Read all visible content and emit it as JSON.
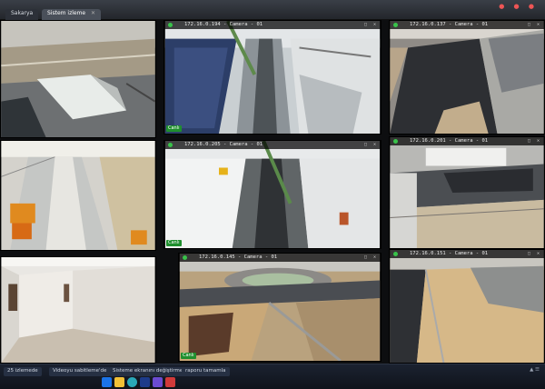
{
  "window": {
    "tabs": [
      {
        "label": "Sakarya",
        "active": false
      },
      {
        "label": "Sistem izleme",
        "active": true
      }
    ]
  },
  "cameras": [
    {
      "ip": "",
      "name": "",
      "status": ""
    },
    {
      "ip": "172.16.0.194 - Camera - 01",
      "name": "",
      "status": "Canlı"
    },
    {
      "ip": "172.16.0.137 - Camera - 01",
      "name": "",
      "status": ""
    },
    {
      "ip": "",
      "name": "",
      "status": ""
    },
    {
      "ip": "172.16.0.205 - Camera - 01",
      "name": "",
      "status": "Canlı"
    },
    {
      "ip": "172.16.0.201 - Camera - 01",
      "name": "",
      "status": ""
    },
    {
      "ip": "",
      "name": "",
      "status": ""
    },
    {
      "ip": "172.16.0.145 - Camera - 01",
      "name": "",
      "status": "Canlı"
    },
    {
      "ip": "172.16.0.151 - Camera - 01",
      "name": "",
      "status": ""
    }
  ],
  "taskbar": {
    "items": [
      "25 izlemede",
      "Videoyu sabitleme'de",
      "Sisteme ekranını değiştirme",
      "raporu tamamla"
    ],
    "icons": [
      "windows-start",
      "explorer",
      "chrome",
      "app",
      "app2",
      "app3",
      "outlook",
      "word",
      "recorder"
    ]
  },
  "colors": {
    "live": "#1f8f2e",
    "rec": "#39c34a",
    "bar": "#0d0e10"
  }
}
